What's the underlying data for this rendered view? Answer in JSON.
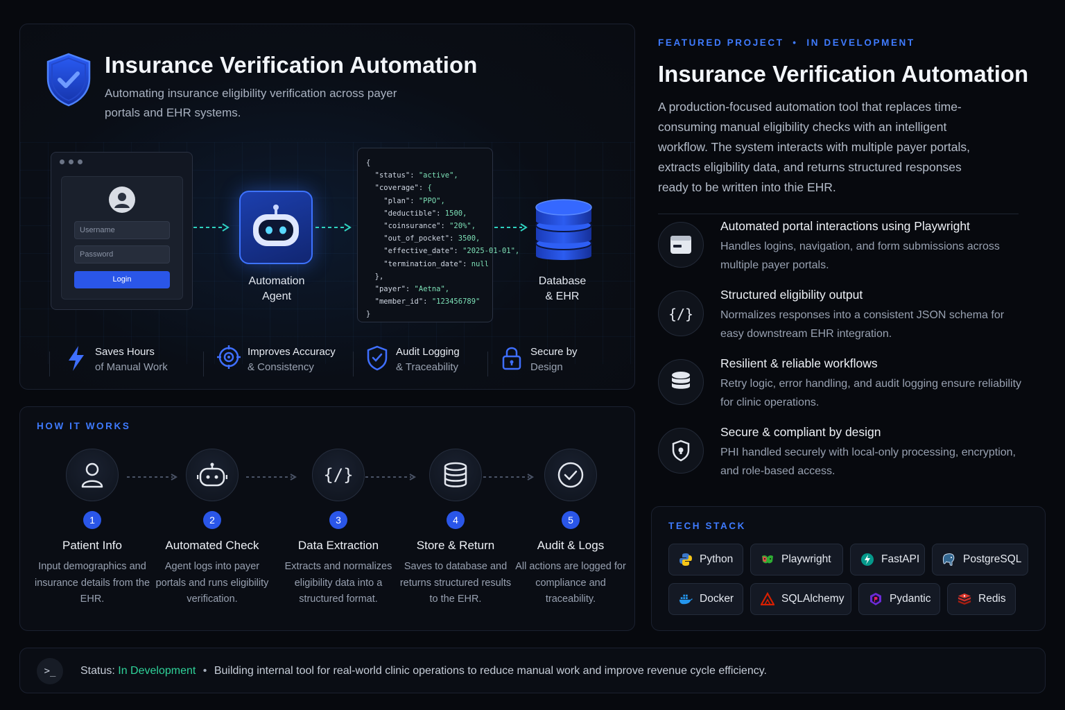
{
  "hero": {
    "title": "Insurance Verification Automation",
    "subtitle": "Automating insurance eligibility verification across payer portals and EHR systems.",
    "login": {
      "username_placeholder": "Username",
      "password_placeholder": "Password",
      "button": "Login"
    },
    "agent_label": "Automation\nAgent",
    "db_label": "Database\n& EHR",
    "json_lines": [
      "{",
      "  \"status\": \"active\",",
      "  \"coverage\": {",
      "    \"plan\": \"PPO\",",
      "    \"deductible\": 1500,",
      "    \"coinsurance\": \"20%\",",
      "    \"out_of_pocket\": 3500,",
      "    \"effective_date\": \"2025-01-01\",",
      "    \"termination_date\": null",
      "  },",
      "  \"payer\": \"Aetna\",",
      "  \"member_id\": \"123456789\"",
      "}"
    ],
    "features": [
      {
        "line1": "Saves Hours",
        "line2": "of Manual Work",
        "icon": "lightning-icon"
      },
      {
        "line1": "Improves Accuracy",
        "line2": "& Consistency",
        "icon": "target-icon"
      },
      {
        "line1": "Audit Logging",
        "line2": "& Traceability",
        "icon": "shield-check-icon"
      },
      {
        "line1": "Secure by",
        "line2": "Design",
        "icon": "lock-icon"
      }
    ]
  },
  "how": {
    "label": "HOW IT WORKS",
    "steps": [
      {
        "num": "1",
        "title": "Patient Info",
        "desc": "Input demographics and insurance details from the EHR.",
        "icon": "user-icon"
      },
      {
        "num": "2",
        "title": "Automated Check",
        "desc": "Agent logs into payer portals and runs eligibility verification.",
        "icon": "robot-icon"
      },
      {
        "num": "3",
        "title": "Data Extraction",
        "desc": "Extracts and normalizes eligibility data into a structured format.",
        "icon": "code-icon"
      },
      {
        "num": "4",
        "title": "Store & Return",
        "desc": "Saves to database and returns structured results to the EHR.",
        "icon": "database-icon"
      },
      {
        "num": "5",
        "title": "Audit & Logs",
        "desc": "All actions are logged for compliance and traceability.",
        "icon": "check-circle-icon"
      }
    ]
  },
  "right": {
    "eyebrow": "FEATURED PROJECT  •  IN DEVELOPMENT",
    "title": "Insurance Verification Automation",
    "description": "A production-focused automation tool that replaces time-consuming manual eligibility checks with an intelligent workflow. The system interacts with multiple payer portals, extracts eligibility data, and returns structured responses ready to be written into thie EHR.",
    "features": [
      {
        "title": "Automated portal interactions using Playwright",
        "desc": "Handles logins, navigation, and form submissions across multiple payer portals.",
        "icon": "browser-window-icon"
      },
      {
        "title": "Structured eligibility output",
        "desc": "Normalizes responses into a consistent JSON schema for easy downstream EHR integration.",
        "icon": "code-braces-icon"
      },
      {
        "title": "Resilient & reliable workflows",
        "desc": "Retry logic, error handling, and audit logging ensure reliability for clinic operations.",
        "icon": "database-icon"
      },
      {
        "title": "Secure & compliant by design",
        "desc": "PHI handled securely with local-only processing, encryption, and role-based access.",
        "icon": "shield-lock-icon"
      }
    ]
  },
  "tech": {
    "label": "TECH STACK",
    "items": [
      {
        "name": "Python",
        "icon": "python-icon",
        "color": "#3b77c9"
      },
      {
        "name": "Playwright",
        "icon": "playwright-icon",
        "color": "#2ead33"
      },
      {
        "name": "FastAPI",
        "icon": "fastapi-icon",
        "color": "#05998b"
      },
      {
        "name": "PostgreSQL",
        "icon": "postgresql-icon",
        "color": "#336791"
      },
      {
        "name": "Docker",
        "icon": "docker-icon",
        "color": "#2496ed"
      },
      {
        "name": "SQLAlchemy",
        "icon": "sqlalchemy-icon",
        "color": "#d71f00"
      },
      {
        "name": "Pydantic",
        "icon": "pydantic-icon",
        "color": "#e92063"
      },
      {
        "name": "Redis",
        "icon": "redis-icon",
        "color": "#dc382d"
      }
    ]
  },
  "status": {
    "prompt": ">_",
    "label": "Status:",
    "value": "In Development",
    "separator": "•",
    "message": "Building internal tool for real-world clinic operations to reduce manual work and improve revenue cycle efficiency."
  },
  "colors": {
    "accent": "#3f7bff",
    "green": "#2fd39a",
    "cyan_arrow": "#2fd3c0"
  }
}
